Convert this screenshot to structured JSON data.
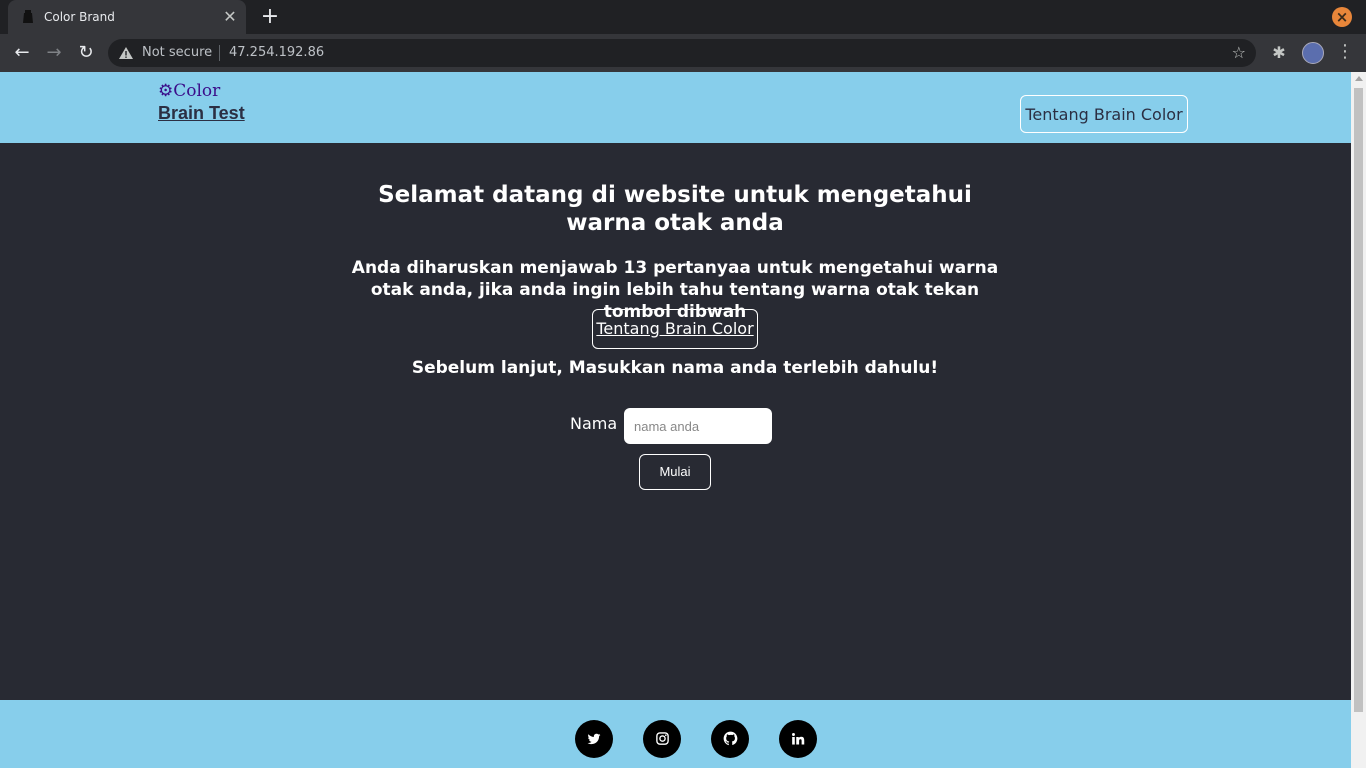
{
  "browser": {
    "tab_title": "Color Brand",
    "tab_close": "✕",
    "new_tab": "+",
    "security_label": "Not secure",
    "url": "47.254.192.86",
    "bookmark_icon": "star-icon",
    "extensions_icon": "puzzle-icon",
    "menu_icon": "kebab-icon"
  },
  "header": {
    "logo_line1": "Color",
    "logo_line2": "Brain Test",
    "about_button": "Tentang Brain Color"
  },
  "main": {
    "title": "Selamat datang di website untuk mengetahui warna otak anda",
    "instructions": "Anda diharuskan menjawab 13 pertanyaa untuk mengetahui warna otak anda, jika anda ingin lebih tahu tentang warna otak tekan tombol dibwah",
    "about_button": "Tentang Brain Color",
    "prompt": "Sebelum lanjut, Masukkan nama anda terlebih dahulu!",
    "name_label": "Nama",
    "name_placeholder": "nama anda",
    "name_value": "",
    "start_button": "Mulai"
  },
  "footer": {
    "socials": [
      {
        "icon": "twitter-icon",
        "glyph": "🐦"
      },
      {
        "icon": "instagram-icon",
        "glyph": "◎"
      },
      {
        "icon": "github-icon",
        "glyph": "●"
      },
      {
        "icon": "linkedin-icon",
        "glyph": "in"
      }
    ]
  },
  "colors": {
    "header_bg": "#87ceeb",
    "page_bg": "#282a33",
    "logo_color": "#3b0e8a"
  }
}
